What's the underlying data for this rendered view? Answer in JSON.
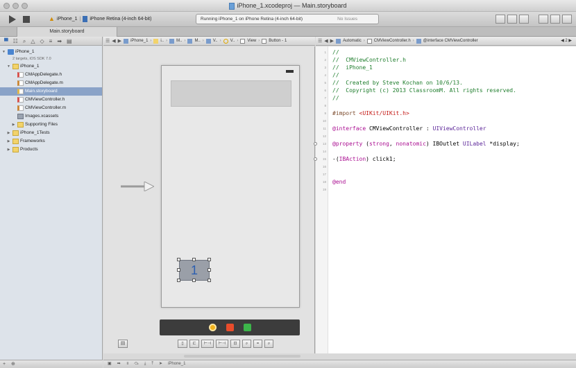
{
  "window": {
    "title": "iPhone_1.xcodeproj — Main.storyboard"
  },
  "toolbar": {
    "scheme_app": "iPhone_1",
    "scheme_device": "iPhone Retina (4-inch 64-bit)",
    "activity": "Running iPhone_1 on iPhone Retina (4-inch 64-bit)",
    "issues": "No Issues"
  },
  "tab": {
    "label": "Main.storyboard"
  },
  "navigator": {
    "items": [
      {
        "label": "iPhone_1",
        "icon": "project-icon",
        "indent": 0,
        "disclosure": "open"
      },
      {
        "label": "2 targets, iOS SDK 7.0",
        "icon": "",
        "indent": 1,
        "sub": true
      },
      {
        "label": "iPhone_1",
        "icon": "folder-icon",
        "indent": 1,
        "disclosure": "open"
      },
      {
        "label": "CMAppDelegate.h",
        "icon": "header-file-icon",
        "indent": 2
      },
      {
        "label": "CMAppDelegate.m",
        "icon": "implementation-file-icon",
        "indent": 2
      },
      {
        "label": "Main.storyboard",
        "icon": "storyboard-file-icon",
        "indent": 2,
        "selected": true
      },
      {
        "label": "CMViewController.h",
        "icon": "header-file-icon",
        "indent": 2
      },
      {
        "label": "CMViewController.m",
        "icon": "implementation-file-icon",
        "indent": 2
      },
      {
        "label": "Images.xcassets",
        "icon": "asset-catalog-icon",
        "indent": 2
      },
      {
        "label": "Supporting Files",
        "icon": "folder-icon",
        "indent": 2,
        "disclosure": "closed"
      },
      {
        "label": "iPhone_1Tests",
        "icon": "folder-icon",
        "indent": 1,
        "disclosure": "closed"
      },
      {
        "label": "Frameworks",
        "icon": "folder-icon",
        "indent": 1,
        "disclosure": "closed"
      },
      {
        "label": "Products",
        "icon": "folder-icon",
        "indent": 1,
        "disclosure": "closed"
      }
    ]
  },
  "jumpbar_left": {
    "crumbs": [
      "iPhone_1",
      "i..",
      "M..",
      "M..",
      "V..",
      "V..",
      "View",
      "Button - 1"
    ]
  },
  "jumpbar_right": {
    "mode": "Automatic",
    "file": "CMViewController.h",
    "symbol": "@interface CMViewController",
    "counter": "2"
  },
  "storyboard": {
    "button_title": "1"
  },
  "code": {
    "lines": [
      {
        "n": "1",
        "parts": [
          {
            "t": "//",
            "c": "cm"
          }
        ]
      },
      {
        "n": "2",
        "parts": [
          {
            "t": "//  CMViewController.h",
            "c": "cm"
          }
        ]
      },
      {
        "n": "3",
        "parts": [
          {
            "t": "//  iPhone_1",
            "c": "cm"
          }
        ]
      },
      {
        "n": "4",
        "parts": [
          {
            "t": "//",
            "c": "cm"
          }
        ]
      },
      {
        "n": "5",
        "parts": [
          {
            "t": "//  Created by Steve Kochan on 10/6/13.",
            "c": "cm"
          }
        ]
      },
      {
        "n": "6",
        "parts": [
          {
            "t": "//  Copyright (c) 2013 ClassroomM. All rights reserved.",
            "c": "cm"
          }
        ]
      },
      {
        "n": "7",
        "parts": [
          {
            "t": "//",
            "c": "cm"
          }
        ]
      },
      {
        "n": "8",
        "parts": []
      },
      {
        "n": "9",
        "parts": [
          {
            "t": "#import ",
            "c": "pp"
          },
          {
            "t": "<UIKit/UIKit.h>",
            "c": "str"
          }
        ]
      },
      {
        "n": "10",
        "parts": []
      },
      {
        "n": "11",
        "parts": [
          {
            "t": "@interface",
            "c": "kw"
          },
          {
            "t": " CMViewController : ",
            "c": ""
          },
          {
            "t": "UIViewController",
            "c": "ty"
          }
        ]
      },
      {
        "n": "12",
        "parts": []
      },
      {
        "n": "13",
        "connected": true,
        "parts": [
          {
            "t": "@property",
            "c": "kw"
          },
          {
            "t": " (",
            "c": ""
          },
          {
            "t": "strong",
            "c": "kw"
          },
          {
            "t": ", ",
            "c": ""
          },
          {
            "t": "nonatomic",
            "c": "kw"
          },
          {
            "t": ") IBOutlet ",
            "c": ""
          },
          {
            "t": "UILabel",
            "c": "ty"
          },
          {
            "t": " *display;",
            "c": ""
          }
        ]
      },
      {
        "n": "14",
        "parts": []
      },
      {
        "n": "15",
        "connected": true,
        "parts": [
          {
            "t": "-(",
            "c": ""
          },
          {
            "t": "IBAction",
            "c": "kw"
          },
          {
            "t": ") click1;",
            "c": ""
          }
        ]
      },
      {
        "n": "16",
        "parts": []
      },
      {
        "n": "17",
        "parts": []
      },
      {
        "n": "18",
        "parts": [
          {
            "t": "@end",
            "c": "kw"
          }
        ]
      },
      {
        "n": "19",
        "parts": []
      }
    ]
  },
  "status": {
    "target": "iPhone_1"
  },
  "colors": {
    "selection": "#8aa3c8",
    "comment": "#1e7d2c",
    "keyword": "#aa0d91",
    "string": "#c41a16",
    "type": "#5c2699"
  }
}
